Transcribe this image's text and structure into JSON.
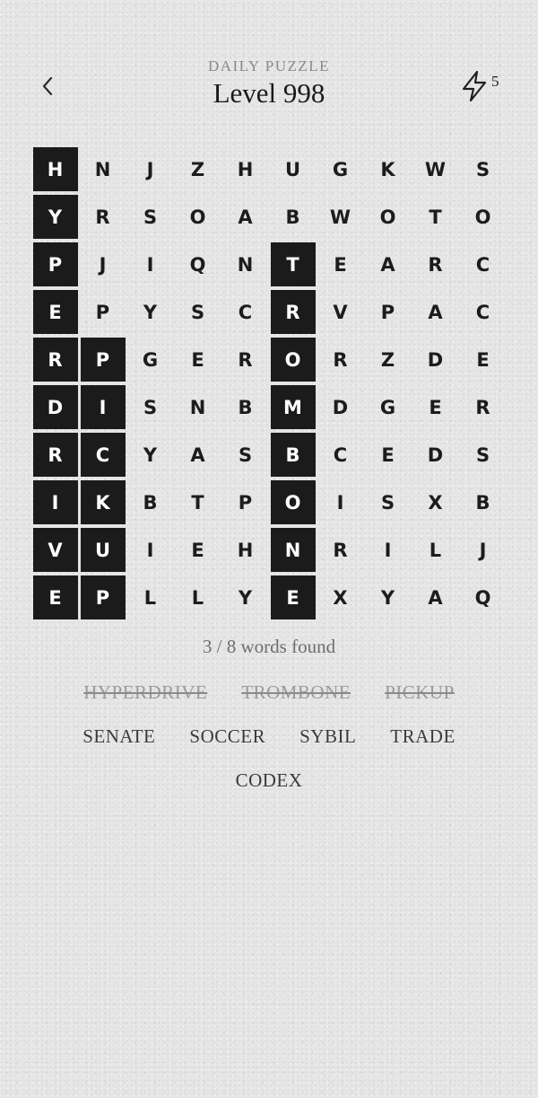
{
  "header": {
    "subtitle": "DAILY PUZZLE",
    "title": "Level 998",
    "hint_count": "5",
    "back_icon": "chevron-left-icon",
    "hint_icon": "lightning-icon"
  },
  "grid": [
    [
      "H",
      "N",
      "J",
      "Z",
      "H",
      "U",
      "G",
      "K",
      "W",
      "S"
    ],
    [
      "Y",
      "R",
      "S",
      "O",
      "A",
      "B",
      "W",
      "O",
      "T",
      "O"
    ],
    [
      "P",
      "J",
      "I",
      "Q",
      "N",
      "T",
      "E",
      "A",
      "R",
      "C"
    ],
    [
      "E",
      "P",
      "Y",
      "S",
      "C",
      "R",
      "V",
      "P",
      "A",
      "C"
    ],
    [
      "R",
      "P",
      "G",
      "E",
      "R",
      "O",
      "R",
      "Z",
      "D",
      "E"
    ],
    [
      "D",
      "I",
      "S",
      "N",
      "B",
      "M",
      "D",
      "G",
      "E",
      "R"
    ],
    [
      "R",
      "C",
      "Y",
      "A",
      "S",
      "B",
      "C",
      "E",
      "D",
      "S"
    ],
    [
      "I",
      "K",
      "B",
      "T",
      "P",
      "O",
      "I",
      "S",
      "X",
      "B"
    ],
    [
      "V",
      "U",
      "I",
      "E",
      "H",
      "N",
      "R",
      "I",
      "L",
      "J"
    ],
    [
      "E",
      "P",
      "L",
      "L",
      "Y",
      "E",
      "X",
      "Y",
      "A",
      "Q"
    ]
  ],
  "highlighted": [
    [
      0,
      0
    ],
    [
      1,
      0
    ],
    [
      2,
      0
    ],
    [
      3,
      0
    ],
    [
      4,
      0
    ],
    [
      5,
      0
    ],
    [
      6,
      0
    ],
    [
      7,
      0
    ],
    [
      8,
      0
    ],
    [
      9,
      0
    ],
    [
      4,
      1
    ],
    [
      5,
      1
    ],
    [
      6,
      1
    ],
    [
      7,
      1
    ],
    [
      8,
      1
    ],
    [
      9,
      1
    ],
    [
      2,
      5
    ],
    [
      3,
      5
    ],
    [
      4,
      5
    ],
    [
      5,
      5
    ],
    [
      6,
      5
    ],
    [
      7,
      5
    ],
    [
      8,
      5
    ],
    [
      9,
      5
    ]
  ],
  "progress_text": "3 / 8 words found",
  "words": [
    {
      "text": "HYPERDRIVE",
      "found": true
    },
    {
      "text": "TROMBONE",
      "found": true
    },
    {
      "text": "PICKUP",
      "found": true
    },
    {
      "text": "SENATE",
      "found": false
    },
    {
      "text": "SOCCER",
      "found": false
    },
    {
      "text": "SYBIL",
      "found": false
    },
    {
      "text": "TRADE",
      "found": false
    },
    {
      "text": "CODEX",
      "found": false
    }
  ],
  "colors": {
    "background": "#e6e6e6",
    "highlight": "#1b1b1b",
    "found_word": "#9a9a9a"
  }
}
